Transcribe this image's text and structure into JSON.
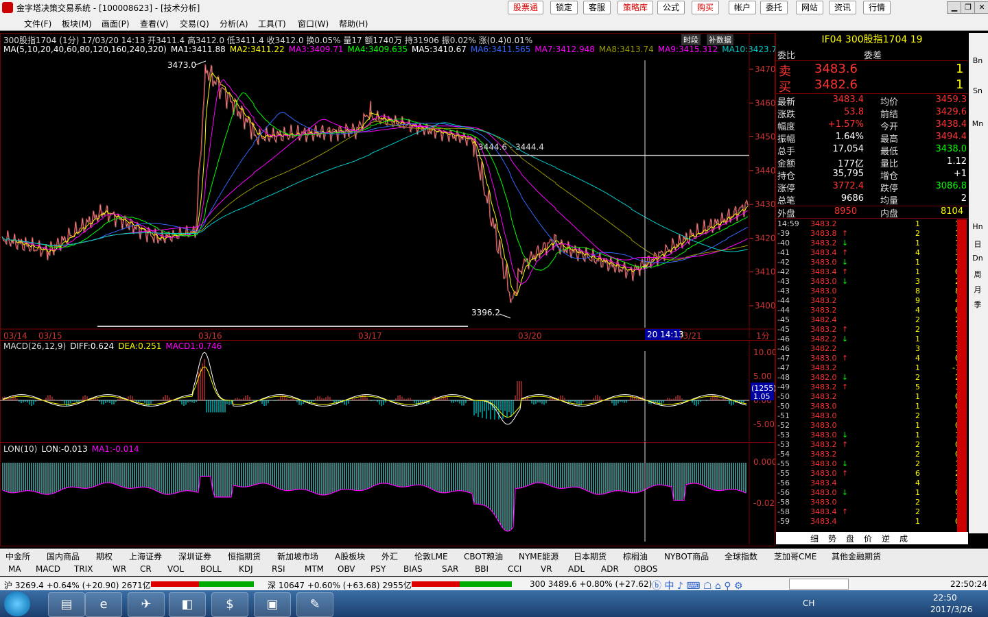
{
  "window": {
    "title": "金字塔决策交易系统 - [100008623] - [技术分析]",
    "buttons": [
      "股票通",
      "锁定",
      "客服",
      "策略库",
      "公式",
      "购买",
      "帐户",
      "委托",
      "网站",
      "资讯",
      "行情"
    ]
  },
  "menu": [
    "文件(F)",
    "板块(M)",
    "画面(P)",
    "查看(V)",
    "交易(Q)",
    "分析(A)",
    "工具(T)",
    "窗口(W)",
    "帮助(H)"
  ],
  "chart": {
    "info_line": "300股指1704 (1分) 17/03/20 14:13 开3411.4 高3412.0 低3411.4 收3412.0 换0.05% 量17 额1740万 持31906 振0.02% 涨(0.4)0.01%",
    "ma_line": [
      "MA(5,10,20,40,60,80,120,160,240,320)",
      "MA1:3411.88",
      "MA2:3411.22",
      "MA3:3409.71",
      "MA4:3409.635",
      "MA5:3410.67",
      "MA6:3411.565",
      "MA7:3412.948",
      "MA8:3413.74",
      "MA9:3415.312",
      "MA10:3423.7"
    ],
    "ma_colors": [
      "#fff",
      "#fff",
      "#ff0",
      "#f0f",
      "#0f0",
      "#fff",
      "#36f",
      "#f0f",
      "#990",
      "#f0f",
      "#0cc"
    ],
    "tags": [
      "时段",
      "补数据"
    ],
    "y_ticks": [
      "3470",
      "3460",
      "3450",
      "3440",
      "3430",
      "3420",
      "3410",
      "3400"
    ],
    "high_label": "3473.0",
    "low_label": "3396.2",
    "cross_label": "3444.6 - 3444.4",
    "dates": [
      "03/14",
      "03/15",
      "03/16",
      "03/17",
      "03/20",
      "03/21"
    ],
    "cursor_time": "20 14:13",
    "period": "1分"
  },
  "macd": {
    "header": [
      "MACD(26,12,9)",
      "DIFF:0.624",
      "DEA:0.251",
      "MACD1:0.746"
    ],
    "y_ticks": [
      "10.00",
      "5.00",
      "0.00",
      "-5.00"
    ],
    "badge1": "(1255)",
    "badge2": "1.05"
  },
  "lon": {
    "header": [
      "LON(10)",
      "LON:-0.013",
      "MA1:-0.014"
    ],
    "y_ticks": [
      "0.000",
      "-0.020"
    ]
  },
  "quote": {
    "title": "IF04  300股指1704  19",
    "wb_label": "委比",
    "wc_label": "委差",
    "sell": {
      "label": "卖",
      "price": "3483.6",
      "vol": "1"
    },
    "buy": {
      "label": "买",
      "price": "3482.6",
      "vol": "1"
    },
    "rows": [
      [
        "最新",
        "3483.4",
        "均价",
        "3459.3"
      ],
      [
        "涨跌",
        "53.8",
        "前结",
        "3429.6"
      ],
      [
        "幅度",
        "+1.57%",
        "今开",
        "3438.4"
      ],
      [
        "振幅",
        "1.64%",
        "最高",
        "3494.4"
      ],
      [
        "总手",
        "17,054",
        "最低",
        "3438.0"
      ],
      [
        "金额",
        "177亿",
        "量比",
        "1.12"
      ],
      [
        "持仓",
        "35,795",
        "增仓",
        "+1"
      ],
      [
        "涨停",
        "3772.4",
        "跌停",
        "3086.8"
      ],
      [
        "总笔",
        "9686",
        "均量",
        "2"
      ]
    ],
    "outer": {
      "l1": "外盘",
      "v1": "8950",
      "l2": "内盘",
      "v2": "8104"
    },
    "ticks": [
      [
        "14:59",
        "3483.2",
        "",
        "1",
        "1"
      ],
      [
        "-39",
        "3483.8",
        "↑",
        "2",
        "1"
      ],
      [
        "-40",
        "3483.2",
        "↓",
        "1",
        "1"
      ],
      [
        "-41",
        "3483.4",
        "↑",
        "4",
        "3"
      ],
      [
        "-42",
        "3483.0",
        "↓",
        "1",
        "1"
      ],
      [
        "-42",
        "3483.4",
        "↑",
        "1",
        "0"
      ],
      [
        "-43",
        "3483.0",
        "↓",
        "3",
        "2"
      ],
      [
        "-43",
        "3483.0",
        "",
        "8",
        "8"
      ],
      [
        "-44",
        "3483.2",
        "",
        "9",
        "4"
      ],
      [
        "-44",
        "3483.2",
        "",
        "4",
        "0"
      ],
      [
        "-45",
        "3482.4",
        "",
        "2",
        "2"
      ],
      [
        "-45",
        "3483.2",
        "↑",
        "2",
        "1"
      ],
      [
        "-46",
        "3482.2",
        "↓",
        "1",
        "1"
      ],
      [
        "-46",
        "3482.2",
        "",
        "3",
        "3"
      ],
      [
        "-47",
        "3483.0",
        "↑",
        "4",
        "0"
      ],
      [
        "-47",
        "3483.2",
        "",
        "1",
        "-1"
      ],
      [
        "-48",
        "3482.0",
        "↓",
        "2",
        "2"
      ],
      [
        "-49",
        "3483.2",
        "↑",
        "5",
        "1"
      ],
      [
        "-50",
        "3483.2",
        "",
        "1",
        "0"
      ],
      [
        "-50",
        "3483.0",
        "",
        "1",
        "0"
      ],
      [
        "-51",
        "3483.0",
        "",
        "2",
        "1"
      ],
      [
        "-52",
        "3483.0",
        "",
        "1",
        "0"
      ],
      [
        "-53",
        "3483.0",
        "↓",
        "1",
        "1"
      ],
      [
        "-53",
        "3483.2",
        "↑",
        "2",
        "0"
      ],
      [
        "-54",
        "3483.2",
        "",
        "2",
        "0"
      ],
      [
        "-55",
        "3483.0",
        "↓",
        "2",
        "1"
      ],
      [
        "-55",
        "3483.0",
        "↑",
        "6",
        "2"
      ],
      [
        "-56",
        "3483.4",
        "",
        "4",
        "3"
      ],
      [
        "-56",
        "3483.0",
        "↓",
        "1",
        "0"
      ],
      [
        "-58",
        "3483.0",
        "",
        "2",
        "1"
      ],
      [
        "-58",
        "3483.4",
        "↑",
        "2",
        "1"
      ],
      [
        "-59",
        "3483.4",
        "",
        "1",
        "0"
      ]
    ],
    "bottom_tabs": [
      "细",
      "势",
      "盘",
      "价",
      "逆",
      "成"
    ]
  },
  "right_tools": [
    "Bn",
    "Sn",
    "Mn",
    "Hn",
    "日",
    "Dn",
    "周",
    "月",
    "季"
  ],
  "tabs1": [
    "中金所",
    "国内商品",
    "期权",
    "上海证券",
    "深圳证券",
    "恒指期货",
    "新加坡市场",
    "A股板块",
    "外汇",
    "伦敦LME",
    "CBOT粮油",
    "NYME能源",
    "日本期货",
    "棕榈油",
    "NYBOT商品",
    "全球指数",
    "芝加哥CME",
    "其他金融期货"
  ],
  "tabs2": [
    "MA",
    "MACD",
    "TRIX",
    "WR",
    "CR",
    "VOL",
    "BOLL",
    "KDJ",
    "RSI",
    "MTM",
    "OBV",
    "PSY",
    "BIAS",
    "SAR",
    "BBI",
    "CCI",
    "VR",
    "ADL",
    "ADR",
    "OBOS"
  ],
  "status": {
    "sh": "沪 3269.4 +0.64% (+20.90) 2671亿",
    "sz": "深 10647 +0.60% (+63.68) 2955亿",
    "hs300": "300 3489.6 +0.80% (+27.62)",
    "clock": "22:50:24"
  },
  "taskbar": {
    "time": "22:50",
    "date": "2017/3/26",
    "lang": "CH"
  }
}
